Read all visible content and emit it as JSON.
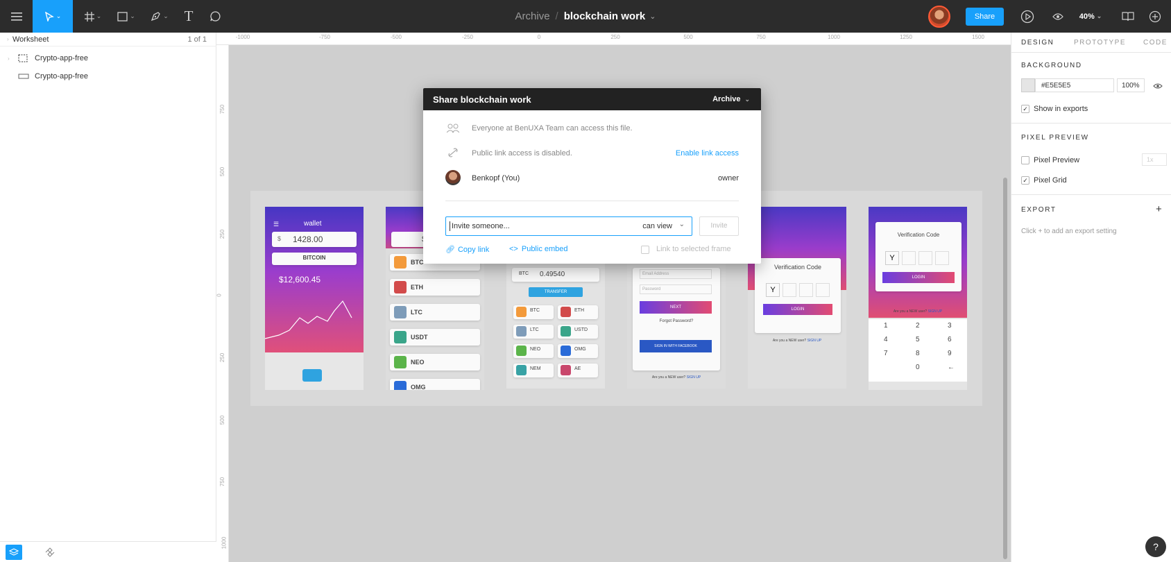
{
  "toolbar": {
    "project": "Archive",
    "separator": "/",
    "file_name": "blockchain work",
    "file_caret": "⌄",
    "share_label": "Share",
    "zoom_label": "40%",
    "text_tool": "T"
  },
  "left_panel": {
    "page_name": "Worksheet",
    "page_count": "1 of 1",
    "layers": [
      {
        "label": "Crypto-app-free",
        "icon": "frame-icon"
      },
      {
        "label": "Crypto-app-free",
        "icon": "rectangle-icon"
      }
    ]
  },
  "ruler": {
    "top": [
      "-1000",
      "-750",
      "-500",
      "-250",
      "0",
      "250",
      "500",
      "750",
      "1000",
      "1250",
      "1500"
    ],
    "left": [
      "750",
      "500",
      "250",
      "0",
      "250",
      "500",
      "750",
      "1000"
    ]
  },
  "share_dialog": {
    "title": "Share blockchain work",
    "project_select": "Archive",
    "team_access": "Everyone at BenUXA Team can access this file.",
    "public_link": "Public link access is disabled.",
    "enable_link": "Enable link access",
    "member_name": "Benkopf (You)",
    "member_role": "owner",
    "invite_placeholder": "Invite someone...",
    "permission": "can view",
    "invite_button": "Invite",
    "copy_link": "Copy link",
    "public_embed": "Public embed",
    "link_to_frame": "Link to selected frame"
  },
  "right_panel": {
    "tabs": [
      "DESIGN",
      "PROTOTYPE",
      "CODE"
    ],
    "background_title": "BACKGROUND",
    "background_hex": "#E5E5E5",
    "background_opacity": "100%",
    "show_in_exports": "Show in exports",
    "pixel_preview_title": "PIXEL PREVIEW",
    "pixel_preview": "Pixel Preview",
    "pixel_preview_scale": "1x",
    "pixel_grid": "Pixel Grid",
    "export_title": "EXPORT",
    "export_hint": "Click + to add an export setting",
    "add": "+"
  },
  "help": "?",
  "mockups": {
    "wallet": {
      "title": "wallet",
      "balance": "1428.00",
      "currency": "$",
      "coin": "BITCOIN",
      "price": "$12,600.45"
    },
    "list": {
      "balance": "$1",
      "coins": [
        "BTC",
        "ETH",
        "LTC",
        "USDT",
        "NEO",
        "OMG"
      ]
    },
    "convert": {
      "pair": "BTC",
      "amount": "0.49540",
      "action": "TRANSFER",
      "coins": [
        "BTC",
        "ETH",
        "LTC",
        "USTD",
        "NEO",
        "OMG",
        "NEM",
        "AE"
      ]
    },
    "login": {
      "email": "Email Address",
      "password": "Password",
      "next": "NEXT",
      "forgot": "Forgot Password?",
      "social": "SIGN IN WITH FACEBOOK",
      "signup_text": "Are you a NEW user?",
      "signup_link": "SIGN UP"
    },
    "verify": {
      "title": "Verification Code",
      "first_digit": "Y",
      "login": "LOGIN",
      "signup_text": "Are you a NEW user?",
      "signup_link": "SIGN UP"
    },
    "verify_keypad": {
      "title": "Verification Code",
      "first_digit": "Y",
      "login": "LOGIN",
      "keys": [
        "1",
        "2",
        "3",
        "4",
        "5",
        "6",
        "7",
        "8",
        "9",
        "0",
        "←"
      ],
      "signup_text": "Are you a NEW user?",
      "signup_link": "SIGN UP"
    }
  },
  "colors": {
    "accent": "#18a0fb",
    "toolbar": "#2c2c2c",
    "canvas": "#cfcfcf",
    "dialog_header": "#222222"
  }
}
